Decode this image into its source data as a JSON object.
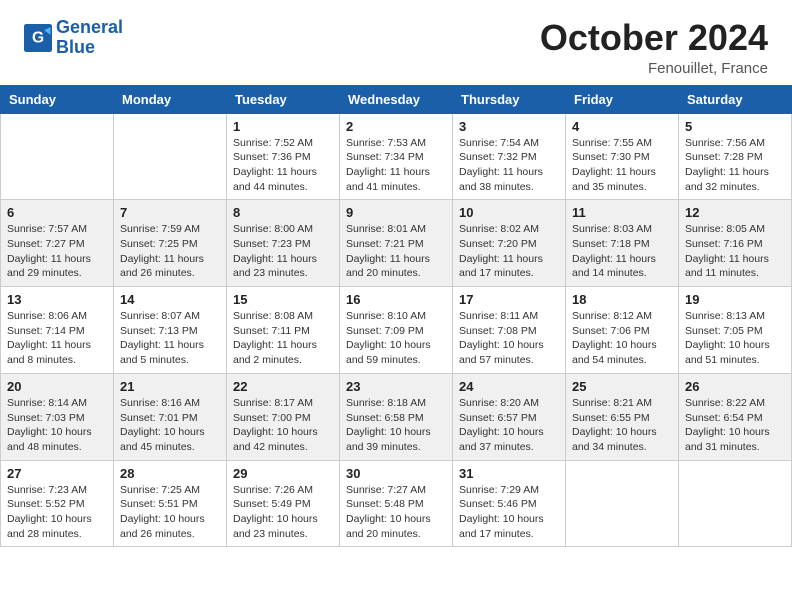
{
  "header": {
    "logo_line1": "General",
    "logo_line2": "Blue",
    "month": "October 2024",
    "location": "Fenouillet, France"
  },
  "weekdays": [
    "Sunday",
    "Monday",
    "Tuesday",
    "Wednesday",
    "Thursday",
    "Friday",
    "Saturday"
  ],
  "weeks": [
    [
      {
        "day": "",
        "info": ""
      },
      {
        "day": "",
        "info": ""
      },
      {
        "day": "1",
        "info": "Sunrise: 7:52 AM\nSunset: 7:36 PM\nDaylight: 11 hours and 44 minutes."
      },
      {
        "day": "2",
        "info": "Sunrise: 7:53 AM\nSunset: 7:34 PM\nDaylight: 11 hours and 41 minutes."
      },
      {
        "day": "3",
        "info": "Sunrise: 7:54 AM\nSunset: 7:32 PM\nDaylight: 11 hours and 38 minutes."
      },
      {
        "day": "4",
        "info": "Sunrise: 7:55 AM\nSunset: 7:30 PM\nDaylight: 11 hours and 35 minutes."
      },
      {
        "day": "5",
        "info": "Sunrise: 7:56 AM\nSunset: 7:28 PM\nDaylight: 11 hours and 32 minutes."
      }
    ],
    [
      {
        "day": "6",
        "info": "Sunrise: 7:57 AM\nSunset: 7:27 PM\nDaylight: 11 hours and 29 minutes."
      },
      {
        "day": "7",
        "info": "Sunrise: 7:59 AM\nSunset: 7:25 PM\nDaylight: 11 hours and 26 minutes."
      },
      {
        "day": "8",
        "info": "Sunrise: 8:00 AM\nSunset: 7:23 PM\nDaylight: 11 hours and 23 minutes."
      },
      {
        "day": "9",
        "info": "Sunrise: 8:01 AM\nSunset: 7:21 PM\nDaylight: 11 hours and 20 minutes."
      },
      {
        "day": "10",
        "info": "Sunrise: 8:02 AM\nSunset: 7:20 PM\nDaylight: 11 hours and 17 minutes."
      },
      {
        "day": "11",
        "info": "Sunrise: 8:03 AM\nSunset: 7:18 PM\nDaylight: 11 hours and 14 minutes."
      },
      {
        "day": "12",
        "info": "Sunrise: 8:05 AM\nSunset: 7:16 PM\nDaylight: 11 hours and 11 minutes."
      }
    ],
    [
      {
        "day": "13",
        "info": "Sunrise: 8:06 AM\nSunset: 7:14 PM\nDaylight: 11 hours and 8 minutes."
      },
      {
        "day": "14",
        "info": "Sunrise: 8:07 AM\nSunset: 7:13 PM\nDaylight: 11 hours and 5 minutes."
      },
      {
        "day": "15",
        "info": "Sunrise: 8:08 AM\nSunset: 7:11 PM\nDaylight: 11 hours and 2 minutes."
      },
      {
        "day": "16",
        "info": "Sunrise: 8:10 AM\nSunset: 7:09 PM\nDaylight: 10 hours and 59 minutes."
      },
      {
        "day": "17",
        "info": "Sunrise: 8:11 AM\nSunset: 7:08 PM\nDaylight: 10 hours and 57 minutes."
      },
      {
        "day": "18",
        "info": "Sunrise: 8:12 AM\nSunset: 7:06 PM\nDaylight: 10 hours and 54 minutes."
      },
      {
        "day": "19",
        "info": "Sunrise: 8:13 AM\nSunset: 7:05 PM\nDaylight: 10 hours and 51 minutes."
      }
    ],
    [
      {
        "day": "20",
        "info": "Sunrise: 8:14 AM\nSunset: 7:03 PM\nDaylight: 10 hours and 48 minutes."
      },
      {
        "day": "21",
        "info": "Sunrise: 8:16 AM\nSunset: 7:01 PM\nDaylight: 10 hours and 45 minutes."
      },
      {
        "day": "22",
        "info": "Sunrise: 8:17 AM\nSunset: 7:00 PM\nDaylight: 10 hours and 42 minutes."
      },
      {
        "day": "23",
        "info": "Sunrise: 8:18 AM\nSunset: 6:58 PM\nDaylight: 10 hours and 39 minutes."
      },
      {
        "day": "24",
        "info": "Sunrise: 8:20 AM\nSunset: 6:57 PM\nDaylight: 10 hours and 37 minutes."
      },
      {
        "day": "25",
        "info": "Sunrise: 8:21 AM\nSunset: 6:55 PM\nDaylight: 10 hours and 34 minutes."
      },
      {
        "day": "26",
        "info": "Sunrise: 8:22 AM\nSunset: 6:54 PM\nDaylight: 10 hours and 31 minutes."
      }
    ],
    [
      {
        "day": "27",
        "info": "Sunrise: 7:23 AM\nSunset: 5:52 PM\nDaylight: 10 hours and 28 minutes."
      },
      {
        "day": "28",
        "info": "Sunrise: 7:25 AM\nSunset: 5:51 PM\nDaylight: 10 hours and 26 minutes."
      },
      {
        "day": "29",
        "info": "Sunrise: 7:26 AM\nSunset: 5:49 PM\nDaylight: 10 hours and 23 minutes."
      },
      {
        "day": "30",
        "info": "Sunrise: 7:27 AM\nSunset: 5:48 PM\nDaylight: 10 hours and 20 minutes."
      },
      {
        "day": "31",
        "info": "Sunrise: 7:29 AM\nSunset: 5:46 PM\nDaylight: 10 hours and 17 minutes."
      },
      {
        "day": "",
        "info": ""
      },
      {
        "day": "",
        "info": ""
      }
    ]
  ]
}
